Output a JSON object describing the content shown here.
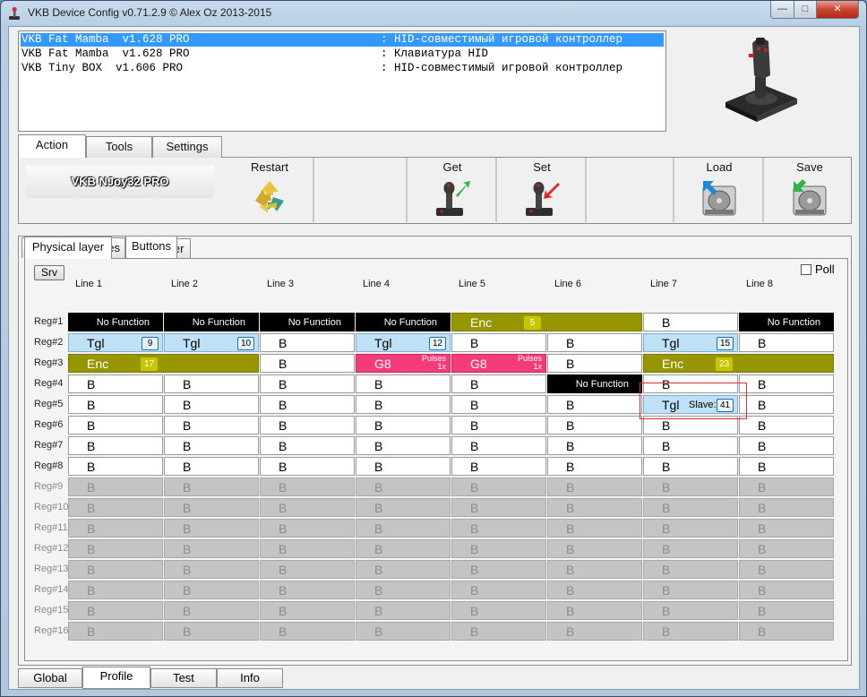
{
  "window": {
    "title": "VKB Device Config v0.71.2.9 © Alex Oz 2013-2015",
    "min": "—",
    "max": "□",
    "close": "✕"
  },
  "devices": [
    {
      "name": "VKB Fat Mamba  v1.628 PRO",
      "desc": ": HID-совместимый игровой контроллер",
      "selected": true
    },
    {
      "name": "VKB Fat Mamba  v1.628 PRO",
      "desc": ": Клавиатура HID",
      "selected": false
    },
    {
      "name": "VKB Tiny BOX  v1.606 PRO",
      "desc": ": HID-совместимый игровой контроллер",
      "selected": false
    }
  ],
  "top_tabs": [
    "Action",
    "Tools",
    "Settings"
  ],
  "toolbar": {
    "device_label": "VKB NJoy32 PRO",
    "restart": "Restart",
    "get": "Get",
    "set": "Set",
    "load": "Load",
    "save": "Save"
  },
  "main_tabs": [
    "Common -n- Axes",
    "Buttons"
  ],
  "layer_tabs": [
    "Physical layer",
    "Logical layer"
  ],
  "srv": "Srv",
  "poll": "Poll",
  "lines": [
    "Line 1",
    "Line 2",
    "Line 3",
    "Line 4",
    "Line 5",
    "Line 6",
    "Line 7",
    "Line 8"
  ],
  "regs": [
    "Reg#1",
    "Reg#2",
    "Reg#3",
    "Reg#4",
    "Reg#5",
    "Reg#6",
    "Reg#7",
    "Reg#8",
    "Reg#9",
    "Reg#10",
    "Reg#11",
    "Reg#12",
    "Reg#13",
    "Reg#14",
    "Reg#15",
    "Reg#16"
  ],
  "grid": [
    [
      {
        "t": "nf",
        "l": "No Function"
      },
      {
        "t": "nf",
        "l": "No Function"
      },
      {
        "t": "nf",
        "l": "No Function"
      },
      {
        "t": "nf",
        "l": "No Function"
      },
      {
        "t": "enc",
        "l": "Enc",
        "n": "5",
        "span": 2
      },
      null,
      {
        "t": "b",
        "l": "B"
      },
      {
        "t": "nf",
        "l": "No Function"
      }
    ],
    [
      {
        "t": "tgl",
        "l": "Tgl",
        "n": "9"
      },
      {
        "t": "tgl",
        "l": "Tgl",
        "n": "10"
      },
      {
        "t": "b",
        "l": "B"
      },
      {
        "t": "tgl",
        "l": "Tgl",
        "n": "12"
      },
      {
        "t": "b",
        "l": "B"
      },
      {
        "t": "b",
        "l": "B"
      },
      {
        "t": "tgl",
        "l": "Tgl",
        "n": "15"
      },
      {
        "t": "b",
        "l": "B"
      }
    ],
    [
      {
        "t": "enc",
        "l": "Enc",
        "n": "17",
        "span": 2
      },
      null,
      {
        "t": "b",
        "l": "B"
      },
      {
        "t": "g8",
        "l": "G8",
        "p1": "Pulses",
        "p2": "1x"
      },
      {
        "t": "g8",
        "l": "G8",
        "p1": "Pulses",
        "p2": "1x"
      },
      {
        "t": "b",
        "l": "B"
      },
      {
        "t": "enc",
        "l": "Enc",
        "n": "23",
        "span": 2
      },
      null
    ],
    [
      {
        "t": "b",
        "l": "B"
      },
      {
        "t": "b",
        "l": "B"
      },
      {
        "t": "b",
        "l": "B"
      },
      {
        "t": "b",
        "l": "B"
      },
      {
        "t": "b",
        "l": "B"
      },
      {
        "t": "nf",
        "l": "No Function"
      },
      {
        "t": "b",
        "l": "B"
      },
      {
        "t": "b",
        "l": "B"
      }
    ],
    [
      {
        "t": "b",
        "l": "B"
      },
      {
        "t": "b",
        "l": "B"
      },
      {
        "t": "b",
        "l": "B"
      },
      {
        "t": "b",
        "l": "B"
      },
      {
        "t": "b",
        "l": "B"
      },
      {
        "t": "b",
        "l": "B"
      },
      {
        "t": "tgl",
        "l": "Tgl",
        "n": "41",
        "slave": "Slave:"
      },
      {
        "t": "b",
        "l": "B"
      }
    ],
    [
      {
        "t": "b",
        "l": "B"
      },
      {
        "t": "b",
        "l": "B"
      },
      {
        "t": "b",
        "l": "B"
      },
      {
        "t": "b",
        "l": "B"
      },
      {
        "t": "b",
        "l": "B"
      },
      {
        "t": "b",
        "l": "B"
      },
      {
        "t": "b",
        "l": "B"
      },
      {
        "t": "b",
        "l": "B"
      }
    ],
    [
      {
        "t": "b",
        "l": "B"
      },
      {
        "t": "b",
        "l": "B"
      },
      {
        "t": "b",
        "l": "B"
      },
      {
        "t": "b",
        "l": "B"
      },
      {
        "t": "b",
        "l": "B"
      },
      {
        "t": "b",
        "l": "B"
      },
      {
        "t": "b",
        "l": "B"
      },
      {
        "t": "b",
        "l": "B"
      }
    ],
    [
      {
        "t": "b",
        "l": "B"
      },
      {
        "t": "b",
        "l": "B"
      },
      {
        "t": "b",
        "l": "B"
      },
      {
        "t": "b",
        "l": "B"
      },
      {
        "t": "b",
        "l": "B"
      },
      {
        "t": "b",
        "l": "B"
      },
      {
        "t": "b",
        "l": "B"
      },
      {
        "t": "b",
        "l": "B"
      }
    ]
  ],
  "disabled_label": "B",
  "bottom_tabs": [
    "Global",
    "Profile",
    "Test",
    "Info"
  ],
  "active": {
    "top_tab": 0,
    "main_tab": 1,
    "layer_tab": 0,
    "bottom_tab": 1
  },
  "colors": {
    "selection": "#3399ff",
    "no_function": "#000000",
    "toggle": "#bfe0f5",
    "encoder": "#969600",
    "g8": "#f53c7a",
    "disabled": "#c4c4c4",
    "highlight": "#e0302c"
  }
}
